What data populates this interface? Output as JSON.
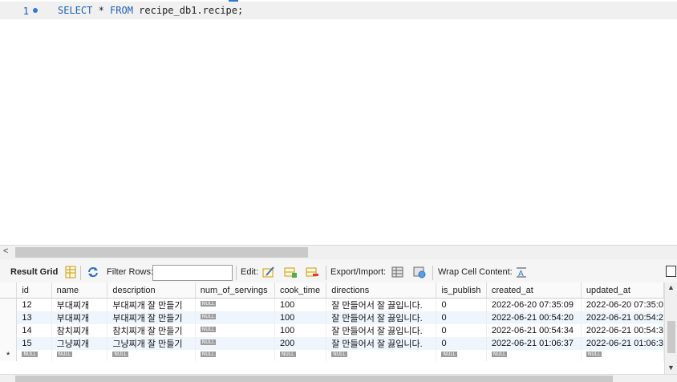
{
  "editor": {
    "line_number": "1",
    "sql_keyword_select": "SELECT",
    "sql_star": " * ",
    "sql_keyword_from": "FROM",
    "sql_rest": " recipe_db1.recipe;"
  },
  "toolbar": {
    "result_grid": "Result Grid",
    "filter_rows": "Filter Rows:",
    "edit": "Edit:",
    "export_import": "Export/Import:",
    "wrap_cell_content": "Wrap Cell Content:"
  },
  "grid": {
    "columns": [
      "id",
      "name",
      "description",
      "num_of_servings",
      "cook_time",
      "directions",
      "is_publish",
      "created_at",
      "updated_at"
    ],
    "null_label": "NULL",
    "new_row_marker": "*",
    "rows": [
      {
        "id": "12",
        "name": "부대찌개",
        "description": "부대찌개 잘 만들기",
        "cook_time": "100",
        "directions": "잘 만들어서 잘 끓입니다.",
        "is_publish": "0",
        "created_at": "2022-06-20 07:35:09",
        "updated_at": "2022-06-20 07:35:0"
      },
      {
        "id": "13",
        "name": "부대찌개",
        "description": "부대찌개 잘 만들기",
        "cook_time": "100",
        "directions": "잘 만들어서 잘 끓입니다.",
        "is_publish": "0",
        "created_at": "2022-06-21 00:54:20",
        "updated_at": "2022-06-21 00:54:2"
      },
      {
        "id": "14",
        "name": "참치찌개",
        "description": "참치찌개 잘 만들기",
        "cook_time": "100",
        "directions": "잘 만들어서 잘 끓입니다.",
        "is_publish": "0",
        "created_at": "2022-06-21 00:54:34",
        "updated_at": "2022-06-21 00:54:3"
      },
      {
        "id": "15",
        "name": "그냥찌개",
        "description": "그냥찌개 잘 만들기",
        "cook_time": "200",
        "directions": "잘 만들어서 잘 끓입니다.",
        "is_publish": "0",
        "created_at": "2022-06-21 01:06:37",
        "updated_at": "2022-06-21 01:06:3"
      }
    ]
  },
  "colors": {
    "keyword": "#1e5fb3",
    "selected_row": "#eef5fd",
    "null_badge": "#9b9b9b"
  },
  "icons": [
    "grid-form-icon",
    "refresh-icon",
    "edit-current-row-icon",
    "add-row-icon",
    "delete-row-icon",
    "export-icon",
    "import-icon",
    "wrap-text-icon"
  ]
}
